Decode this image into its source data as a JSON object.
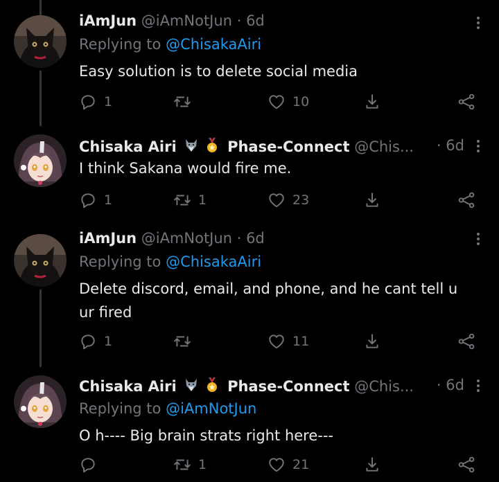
{
  "tweets": [
    {
      "name": "iAmJun",
      "handle": "@iAmNotJun",
      "dot": "·",
      "time": "6d",
      "replying_prefix": "Replying to",
      "replying_to": "@ChisakaAiri",
      "text": "Easy solution is to delete social media",
      "replies": "1",
      "retweets": "",
      "likes": "10"
    },
    {
      "name": "Chisaka Airi",
      "badges": [
        "wolf-emoji",
        "medal-emoji"
      ],
      "name_suffix": "Phase-Connect",
      "handle": "@Chis...",
      "dot": "·",
      "time": "6d",
      "text": "I think Sakana would fire me.",
      "replies": "1",
      "retweets": "1",
      "likes": "23"
    },
    {
      "name": "iAmJun",
      "handle": "@iAmNotJun",
      "dot": "·",
      "time": "6d",
      "replying_prefix": "Replying to",
      "replying_to": "@ChisakaAiri",
      "text_line1": "Delete discord, email, and phone, and he cant tell u",
      "text_line2": "ur fired",
      "replies": "1",
      "retweets": "",
      "likes": "11"
    },
    {
      "name": "Chisaka Airi",
      "badges": [
        "wolf-emoji",
        "medal-emoji"
      ],
      "name_suffix": "Phase-Connect",
      "handle": "@Chis...",
      "dot": "·",
      "time": "6d",
      "replying_prefix": "Replying to",
      "replying_to": "@iAmNotJun",
      "text": "O h---- Big brain strats right here---",
      "replies": "",
      "retweets": "1",
      "likes": "21"
    }
  ],
  "colors": {
    "background": "#000000",
    "text": "#e7e9ea",
    "secondary": "#71767b",
    "mention": "#1d9bf0",
    "thread_line": "#333639"
  }
}
